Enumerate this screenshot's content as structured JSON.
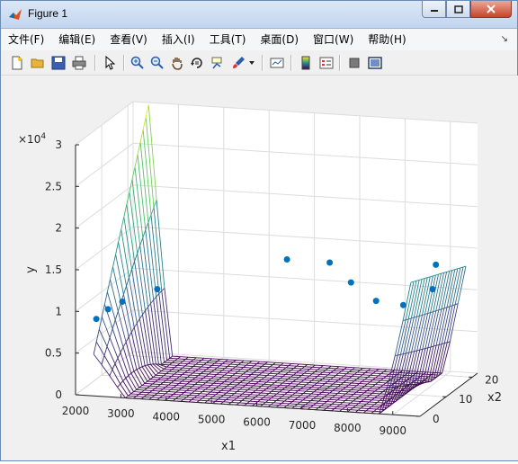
{
  "window": {
    "title": "Figure 1"
  },
  "menu": {
    "items": [
      {
        "label": "文件(F)"
      },
      {
        "label": "编辑(E)"
      },
      {
        "label": "查看(V)"
      },
      {
        "label": "插入(I)"
      },
      {
        "label": "工具(T)"
      },
      {
        "label": "桌面(D)"
      },
      {
        "label": "窗口(W)"
      },
      {
        "label": "帮助(H)"
      }
    ]
  },
  "toolbar": {
    "icons": [
      "new-figure-icon",
      "open-file-icon",
      "save-icon",
      "print-icon",
      "select-arrow-icon",
      "zoom-in-icon",
      "zoom-out-icon",
      "pan-hand-icon",
      "rotate-3d-icon",
      "data-cursor-icon",
      "brush-icon",
      "brush-dropdown-icon",
      "link-plot-icon",
      "colorbar-icon",
      "legend-icon",
      "hide-plot-tools-icon",
      "show-plot-tools-icon"
    ]
  },
  "colors": {
    "accent": "#0072bd",
    "surface_low": "#440154",
    "surface_mid": "#21918c",
    "surface_high": "#fde725"
  },
  "chart_data": {
    "type": "surface-3d",
    "title": "",
    "xlabel": "x1",
    "ylabel": "y",
    "zlabel": "x2",
    "exponent_label": "×10",
    "exponent_value": "4",
    "x_ticks": [
      "2000",
      "3000",
      "4000",
      "5000",
      "6000",
      "7000",
      "8000",
      "9000"
    ],
    "depth_ticks": [
      "0",
      "10",
      "20"
    ],
    "y_ticks": [
      "0",
      "0.5",
      "1",
      "1.5",
      "2",
      "2.5",
      "3"
    ],
    "x_range": [
      2000,
      9600
    ],
    "depth_range": [
      0,
      22
    ],
    "y_range": [
      0,
      30000
    ],
    "grid": true,
    "surface_corners_y": {
      "x_low_depth_low": 5000,
      "x_low_depth_high": 30000,
      "x_high_depth_low": 16000,
      "x_high_depth_high": 13000,
      "min": 0
    },
    "scatter_points": [
      {
        "x": 2400,
        "depth": 1,
        "y": 9000
      },
      {
        "x": 2800,
        "depth": 4,
        "y": 10500
      },
      {
        "x": 3400,
        "depth": 7,
        "y": 11500
      },
      {
        "x": 2600,
        "depth": 2,
        "y": 10000
      },
      {
        "x": 5800,
        "depth": 15,
        "y": 14000
      },
      {
        "x": 6800,
        "depth": 14,
        "y": 14200
      },
      {
        "x": 7500,
        "depth": 10,
        "y": 13000
      },
      {
        "x": 8400,
        "depth": 4,
        "y": 12500
      },
      {
        "x": 9000,
        "depth": 4,
        "y": 12200
      },
      {
        "x": 9200,
        "depth": 13,
        "y": 15000
      },
      {
        "x": 9300,
        "depth": 10,
        "y": 12800
      }
    ]
  }
}
